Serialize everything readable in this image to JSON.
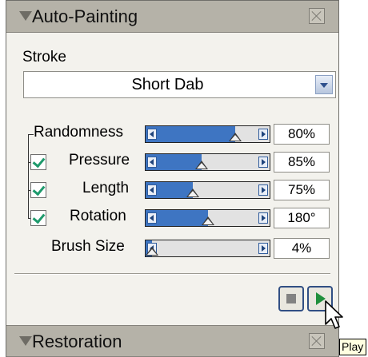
{
  "panel": {
    "title": "Auto-Painting",
    "stroke": {
      "label": "Stroke",
      "selected": "Short Dab"
    },
    "rows": [
      {
        "label": "Randomness",
        "checked": null,
        "fill": 0.72,
        "value": "80%"
      },
      {
        "label": "Pressure",
        "checked": true,
        "fill": 0.45,
        "value": "85%"
      },
      {
        "label": "Length",
        "checked": true,
        "fill": 0.38,
        "value": "75%"
      },
      {
        "label": "Rotation",
        "checked": true,
        "fill": 0.5,
        "value": "180°"
      },
      {
        "label": "Brush Size",
        "checked": null,
        "fill": 0.05,
        "value": "4%"
      }
    ],
    "controls": {
      "stop_icon": "stop-icon",
      "play_icon": "play-icon"
    }
  },
  "collapsed_panel": {
    "title": "Restoration"
  },
  "tooltip": {
    "text": "Play"
  },
  "colors": {
    "slider_fill": "#3e75c2",
    "check": "#1e9a6c",
    "play": "#1f8f3c",
    "titlebar": "#b5b2a8"
  }
}
